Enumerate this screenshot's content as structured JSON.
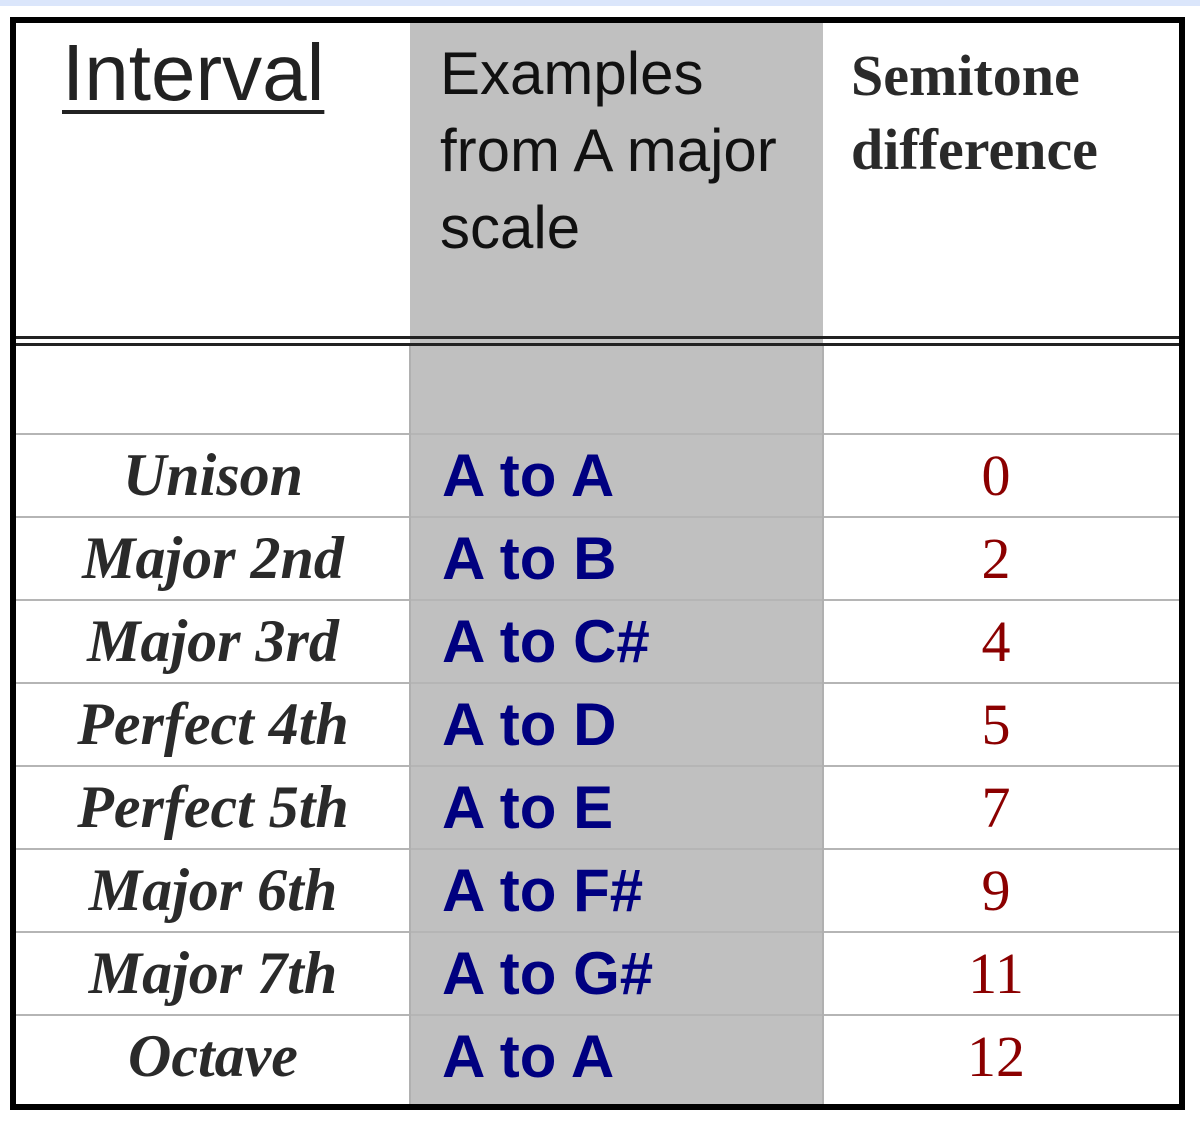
{
  "table": {
    "headers": {
      "interval": "Interval",
      "examples": "Examples from A major scale",
      "semitone": "Semitone difference"
    },
    "colors": {
      "example_text": "#000080",
      "semitone_text": "#8b0000",
      "shaded_column": "#c0c0c0",
      "interval_text": "#2a2a2a"
    },
    "rows": [
      {
        "interval": "Unison",
        "example": "A to A",
        "semitones": "0"
      },
      {
        "interval": "Major 2nd",
        "example": "A to B",
        "semitones": "2"
      },
      {
        "interval": "Major 3rd",
        "example": "A to C#",
        "semitones": "4"
      },
      {
        "interval": "Perfect 4th",
        "example": "A to D",
        "semitones": "5"
      },
      {
        "interval": "Perfect 5th",
        "example": "A to E",
        "semitones": "7"
      },
      {
        "interval": "Major 6th",
        "example": "A to F#",
        "semitones": "9"
      },
      {
        "interval": "Major 7th",
        "example": "A to G#",
        "semitones": "11"
      },
      {
        "interval": "Octave",
        "example": "A to A",
        "semitones": "12"
      }
    ]
  }
}
